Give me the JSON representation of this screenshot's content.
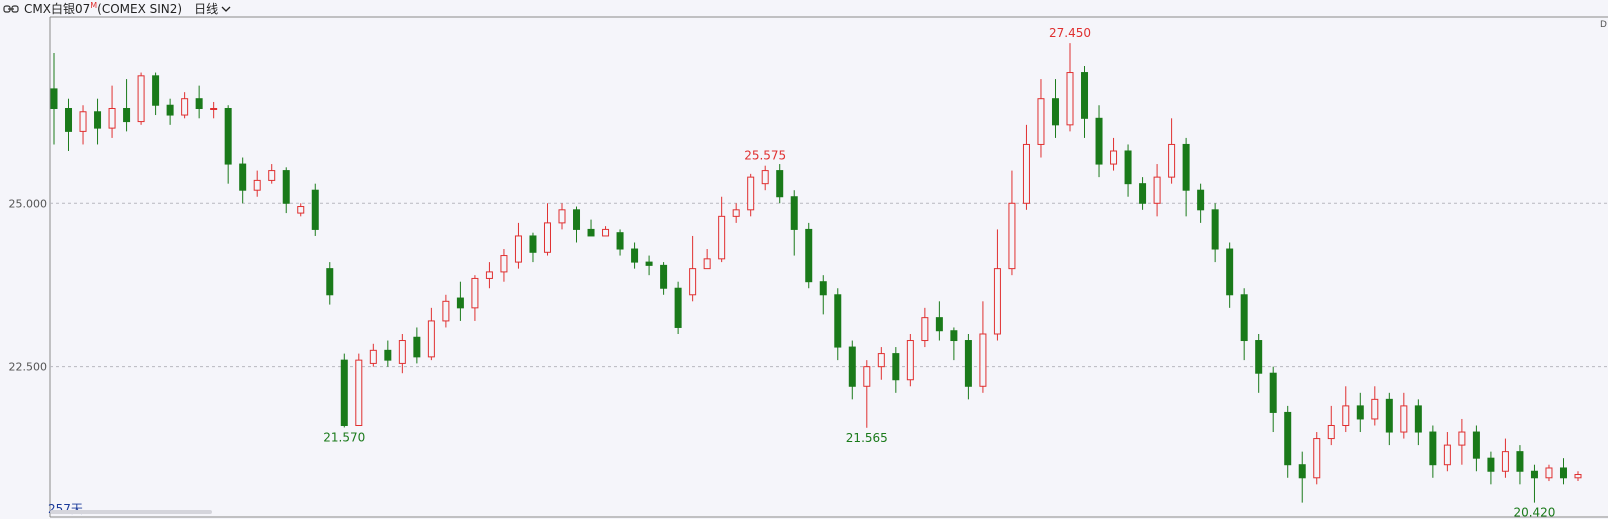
{
  "header": {
    "symbol": "CMX白银07",
    "symbol_sup": "M",
    "desc": "(COMEX SIN2)",
    "period": "日线"
  },
  "right_badge": "D",
  "colors": {
    "up": "#e03030",
    "down": "#1a7a1a",
    "grid": "#b8b8c0",
    "axis": "#8a8a8a",
    "label": "#555555",
    "background": "#f5f5fa"
  },
  "chart_data": {
    "type": "candlestick",
    "ylim": [
      20.2,
      27.85
    ],
    "yticks": [
      25.0,
      22.5
    ],
    "ytick_labels": [
      "25.000",
      "22.500"
    ],
    "grid": "horizontal-dashed",
    "period_label": "257天",
    "annotations": [
      {
        "i": 70,
        "value": 27.45,
        "label": "27.450",
        "kind": "high"
      },
      {
        "i": 49,
        "value": 25.575,
        "label": "25.575",
        "kind": "high"
      },
      {
        "i": 20,
        "value": 21.57,
        "label": "21.570",
        "kind": "low"
      },
      {
        "i": 56,
        "value": 21.565,
        "label": "21.565",
        "kind": "low"
      },
      {
        "i": 102,
        "value": 20.42,
        "label": "20.420",
        "kind": "low"
      }
    ],
    "candles": [
      [
        26.75,
        26.45,
        27.3,
        25.9
      ],
      [
        26.45,
        26.1,
        26.6,
        25.8
      ],
      [
        26.1,
        26.4,
        26.5,
        25.9
      ],
      [
        26.4,
        26.15,
        26.6,
        25.9
      ],
      [
        26.15,
        26.45,
        26.8,
        26.0
      ],
      [
        26.45,
        26.25,
        26.9,
        26.1
      ],
      [
        26.25,
        26.95,
        27.0,
        26.2
      ],
      [
        26.95,
        26.5,
        27.0,
        26.35
      ],
      [
        26.5,
        26.35,
        26.6,
        26.2
      ],
      [
        26.35,
        26.6,
        26.7,
        26.3
      ],
      [
        26.6,
        26.45,
        26.8,
        26.3
      ],
      [
        26.45,
        26.45,
        26.55,
        26.3
      ],
      [
        26.45,
        25.6,
        26.5,
        25.3
      ],
      [
        25.6,
        25.2,
        25.7,
        25.0
      ],
      [
        25.2,
        25.35,
        25.5,
        25.1
      ],
      [
        25.35,
        25.5,
        25.6,
        25.3
      ],
      [
        25.5,
        25.0,
        25.55,
        24.85
      ],
      [
        24.85,
        24.95,
        25.0,
        24.8
      ],
      [
        25.2,
        24.6,
        25.3,
        24.5
      ],
      [
        24.0,
        23.6,
        24.1,
        23.45
      ],
      [
        22.6,
        21.6,
        22.7,
        21.57
      ],
      [
        21.6,
        22.6,
        22.7,
        21.6
      ],
      [
        22.55,
        22.75,
        22.85,
        22.5
      ],
      [
        22.75,
        22.6,
        22.9,
        22.5
      ],
      [
        22.55,
        22.9,
        23.0,
        22.4
      ],
      [
        22.95,
        22.65,
        23.1,
        22.55
      ],
      [
        22.65,
        23.2,
        23.4,
        22.6
      ],
      [
        23.2,
        23.5,
        23.6,
        23.1
      ],
      [
        23.55,
        23.4,
        23.8,
        23.2
      ],
      [
        23.4,
        23.85,
        23.9,
        23.2
      ],
      [
        23.85,
        23.95,
        24.1,
        23.7
      ],
      [
        23.95,
        24.2,
        24.3,
        23.8
      ],
      [
        24.1,
        24.5,
        24.7,
        24.0
      ],
      [
        24.5,
        24.25,
        24.55,
        24.1
      ],
      [
        24.25,
        24.7,
        25.0,
        24.2
      ],
      [
        24.7,
        24.9,
        25.0,
        24.6
      ],
      [
        24.9,
        24.6,
        24.95,
        24.4
      ],
      [
        24.6,
        24.5,
        24.75,
        24.5
      ],
      [
        24.5,
        24.6,
        24.65,
        24.55
      ],
      [
        24.55,
        24.3,
        24.6,
        24.2
      ],
      [
        24.3,
        24.1,
        24.4,
        24.0
      ],
      [
        24.1,
        24.05,
        24.2,
        23.9
      ],
      [
        24.05,
        23.7,
        24.1,
        23.6
      ],
      [
        23.7,
        23.1,
        23.8,
        23.0
      ],
      [
        23.6,
        24.0,
        24.5,
        23.5
      ],
      [
        24.0,
        24.15,
        24.3,
        24.0
      ],
      [
        24.15,
        24.8,
        25.1,
        24.1
      ],
      [
        24.8,
        24.9,
        25.0,
        24.7
      ],
      [
        24.9,
        25.4,
        25.45,
        24.8
      ],
      [
        25.3,
        25.5,
        25.575,
        25.2
      ],
      [
        25.5,
        25.1,
        25.6,
        25.0
      ],
      [
        25.1,
        24.6,
        25.2,
        24.2
      ],
      [
        24.6,
        23.8,
        24.7,
        23.7
      ],
      [
        23.8,
        23.6,
        23.9,
        23.3
      ],
      [
        23.6,
        22.8,
        23.7,
        22.6
      ],
      [
        22.8,
        22.2,
        22.9,
        22.0
      ],
      [
        22.2,
        22.5,
        22.6,
        21.565
      ],
      [
        22.5,
        22.7,
        22.8,
        22.3
      ],
      [
        22.7,
        22.3,
        22.8,
        22.1
      ],
      [
        22.3,
        22.9,
        23.0,
        22.2
      ],
      [
        22.9,
        23.25,
        23.4,
        22.8
      ],
      [
        23.25,
        23.05,
        23.5,
        22.9
      ],
      [
        23.05,
        22.9,
        23.1,
        22.6
      ],
      [
        22.9,
        22.2,
        23.0,
        22.0
      ],
      [
        22.2,
        23.0,
        23.5,
        22.1
      ],
      [
        23.0,
        24.0,
        24.6,
        22.9
      ],
      [
        24.0,
        25.0,
        25.5,
        23.9
      ],
      [
        25.0,
        25.9,
        26.2,
        24.9
      ],
      [
        25.9,
        26.6,
        26.9,
        25.7
      ],
      [
        26.6,
        26.2,
        26.9,
        26.0
      ],
      [
        26.2,
        27.0,
        27.45,
        26.1
      ],
      [
        27.0,
        26.3,
        27.1,
        26.0
      ],
      [
        26.3,
        25.6,
        26.5,
        25.4
      ],
      [
        25.6,
        25.8,
        26.0,
        25.5
      ],
      [
        25.8,
        25.3,
        25.9,
        25.1
      ],
      [
        25.3,
        25.0,
        25.4,
        24.9
      ],
      [
        25.0,
        25.4,
        25.6,
        24.8
      ],
      [
        25.4,
        25.9,
        26.3,
        25.3
      ],
      [
        25.9,
        25.2,
        26.0,
        24.8
      ],
      [
        25.2,
        24.9,
        25.3,
        24.7
      ],
      [
        24.9,
        24.3,
        25.0,
        24.1
      ],
      [
        24.3,
        23.6,
        24.4,
        23.4
      ],
      [
        23.6,
        22.9,
        23.7,
        22.6
      ],
      [
        22.9,
        22.4,
        23.0,
        22.1
      ],
      [
        22.4,
        21.8,
        22.5,
        21.5
      ],
      [
        21.8,
        21.0,
        21.9,
        20.8
      ],
      [
        21.0,
        20.8,
        21.2,
        20.42
      ],
      [
        20.8,
        21.4,
        21.5,
        20.7
      ],
      [
        21.4,
        21.6,
        21.9,
        21.3
      ],
      [
        21.6,
        21.9,
        22.2,
        21.5
      ],
      [
        21.9,
        21.7,
        22.1,
        21.5
      ],
      [
        21.7,
        22.0,
        22.2,
        21.6
      ],
      [
        22.0,
        21.5,
        22.1,
        21.3
      ],
      [
        21.5,
        21.9,
        22.1,
        21.4
      ],
      [
        21.9,
        21.5,
        22.0,
        21.3
      ],
      [
        21.5,
        21.0,
        21.6,
        20.8
      ],
      [
        21.0,
        21.3,
        21.5,
        20.9
      ],
      [
        21.3,
        21.5,
        21.7,
        21.0
      ],
      [
        21.5,
        21.1,
        21.6,
        20.9
      ],
      [
        21.1,
        20.9,
        21.2,
        20.7
      ],
      [
        20.9,
        21.2,
        21.4,
        20.8
      ],
      [
        21.2,
        20.9,
        21.3,
        20.7
      ],
      [
        20.9,
        20.8,
        21.0,
        20.42
      ],
      [
        20.8,
        20.95,
        21.0,
        20.75
      ],
      [
        20.95,
        20.8,
        21.1,
        20.7
      ],
      [
        20.8,
        20.85,
        20.9,
        20.75
      ]
    ]
  }
}
